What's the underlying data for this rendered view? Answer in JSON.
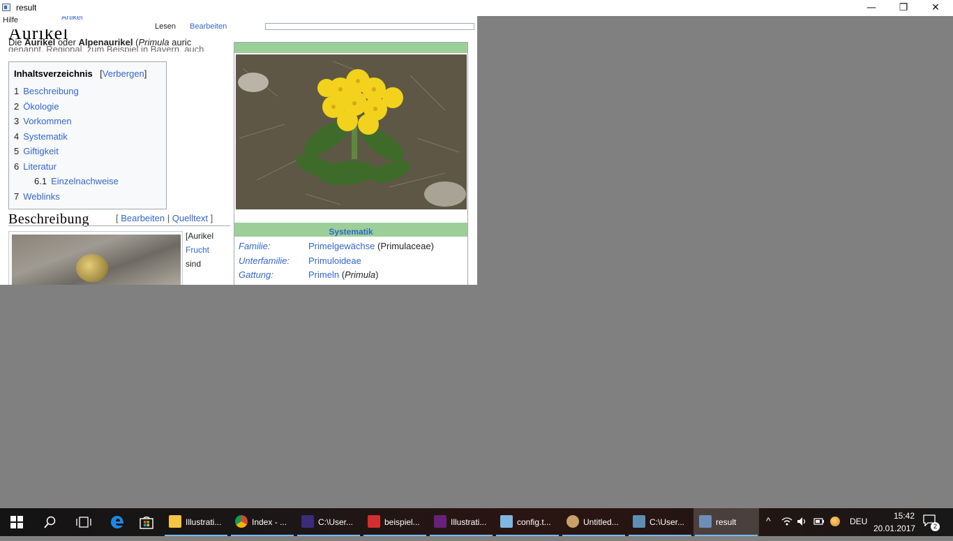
{
  "window": {
    "title": "result",
    "minimize_glyph": "—",
    "maximize_glyph": "❐",
    "close_glyph": "✕"
  },
  "page": {
    "tabs": [
      "Hilfe",
      "Artikel",
      "Lesen",
      "Bearbeiten"
    ],
    "article_title": "Aurikel",
    "intro": {
      "prefix": "Die ",
      "bold1": "Aurikel",
      "mid": " oder ",
      "bold2": "Alpenaurikel",
      "paren_open": " (",
      "latin": "Primula",
      "tail": " auric"
    },
    "intro_line2": "genannt. Regional, zum Beispiel in Bayern, auch",
    "toc": {
      "title": "Inhaltsverzeichnis",
      "toggle_open": "[",
      "toggle_link": "Verbergen",
      "toggle_close": "]",
      "items": [
        {
          "num": "1",
          "label": "Beschreibung"
        },
        {
          "num": "2",
          "label": "Ökologie"
        },
        {
          "num": "3",
          "label": "Vorkommen"
        },
        {
          "num": "4",
          "label": "Systematik"
        },
        {
          "num": "5",
          "label": "Giftigkeit"
        },
        {
          "num": "6",
          "label": "Literatur"
        },
        {
          "num": "6.1",
          "label": "Einzelnachweise"
        },
        {
          "num": "7",
          "label": "Weblinks"
        }
      ]
    },
    "section": {
      "heading": "Beschreibung",
      "edit_open": "[ ",
      "edit_link1": "Bearbeiten",
      "edit_sep": " | ",
      "edit_link2": "Quelltext",
      "edit_close": " ]"
    },
    "side_text": [
      "[Aurikel",
      "Frucht",
      "sind"
    ],
    "infobox": {
      "section_title": "Systematik",
      "rows": [
        {
          "label": "Familie:",
          "value": "Primelgewächse",
          "extra": "Primulaceae"
        },
        {
          "label": "Unterfamilie:",
          "value": "Primuloideae",
          "extra": ""
        },
        {
          "label": "Gattung:",
          "value": "Primeln",
          "extra": "Primula"
        }
      ]
    }
  },
  "taskbar": {
    "apps": [
      {
        "label": "Illustrati...",
        "icon": "folder-icon",
        "color": "#f4c542"
      },
      {
        "label": "Index - ...",
        "icon": "chrome-icon",
        "color": "#db4437"
      },
      {
        "label": "C:\\User...",
        "icon": "jpx-icon",
        "color": "#3c2b7a"
      },
      {
        "label": "beispiel...",
        "icon": "pdf-icon",
        "color": "#d32f2f"
      },
      {
        "label": "Illustrati...",
        "icon": "visual-studio-icon",
        "color": "#68217a"
      },
      {
        "label": "config.t...",
        "icon": "notepad-icon",
        "color": "#7fb7e0"
      },
      {
        "label": "Untitled...",
        "icon": "paint-icon",
        "color": "#c9a06a"
      },
      {
        "label": "C:\\User...",
        "icon": "console-icon",
        "color": "#5d8fb4"
      },
      {
        "label": "result",
        "icon": "window-icon",
        "color": "#6d8fb5"
      }
    ],
    "tray": {
      "language": "DEU",
      "time": "15:42",
      "date": "20.01.2017",
      "notifications": "2"
    }
  },
  "colors": {
    "link": "#3366cc",
    "infobox_green": "#9bcf97",
    "desktop_gray": "#808080",
    "taskbar_active_underline": "#76b9ed"
  }
}
